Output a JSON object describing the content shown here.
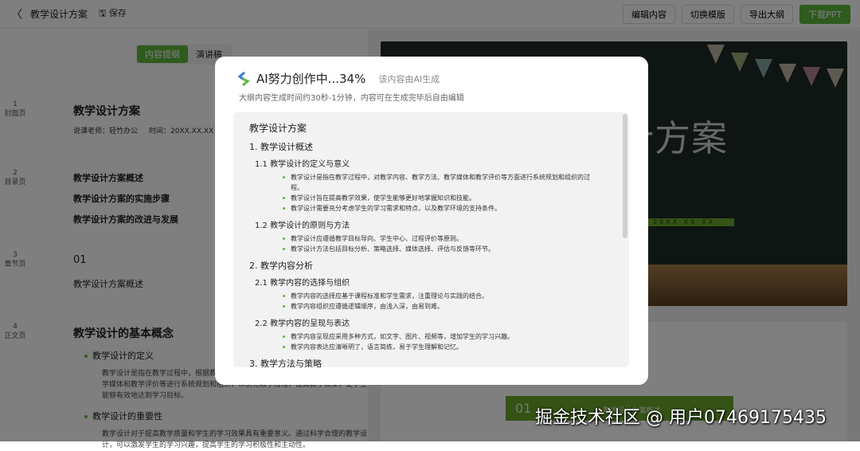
{
  "topbar": {
    "back": "〈",
    "title": "教学设计方案",
    "save": "保存",
    "buttons": [
      "编辑内容",
      "切换模版",
      "导出大纲",
      "下载PPT"
    ]
  },
  "left": {
    "tabs": [
      "内容提纲",
      "演讲稿"
    ],
    "pages": [
      {
        "no": "1",
        "type": "封面页",
        "title": "教学设计方案",
        "teacher": "说课老师：轻竹办公",
        "time": "时间：20XX.XX.XX"
      },
      {
        "no": "2",
        "type": "目录页",
        "items": [
          "教学设计方案概述",
          "教学设计方案的实施步骤",
          "教学设计方案的改进与发展"
        ]
      },
      {
        "no": "3",
        "type": "章节页",
        "num": "01",
        "title": "教学设计方案概述"
      },
      {
        "no": "4",
        "type": "正文页",
        "title": "教学设计的基本概念",
        "b1": "教学设计的定义",
        "b1t": "教学设计是指在教学过程中，根据教学目标和学生特点，对教学内容、教学方法、教学媒体和教学评价等进行系统规划和组织，以优化教学过程，提高教学效果，使学生能够有效地达到学习目标。",
        "b2": "教学设计的重要性",
        "b2t": "教学设计对于提高教学质量和学生的学习效果具有重要意义。通过科学合理的教学设计，可以激发学生的学习兴趣，提高学生的学习积极性和主动性。"
      }
    ]
  },
  "slide": {
    "title": "教学设计方案",
    "date": "20XX XX XX",
    "banner_num": "01",
    "banner_text": "教学设计方案概述"
  },
  "modal": {
    "title": "AI努力创作中...34%",
    "note": "该内容由AI生成",
    "sub": "大纲内容生成时间约30秒-1分钟，内容可在生成完毕后自由编辑",
    "outline": {
      "root": "教学设计方案",
      "s1": "1. 教学设计概述",
      "s11": "1.1 教学设计的定义与意义",
      "s11b": [
        "教学设计是指在教学过程中，对教学内容、教学方法、教学媒体和教学评价等方面进行系统规划和组织的过程。",
        "教学设计旨在提高教学效果，使学生能够更好地掌握知识和技能。",
        "教学设计需要充分考虑学生的学习需求和特点，以及教学环境的支持条件。"
      ],
      "s12": "1.2 教学设计的原则与方法",
      "s12b": [
        "教学设计应遵循教学目标导向、学生中心、过程评价等原则。",
        "教学设计方法包括目标分析、策略选择、媒体选择、评估与反馈等环节。"
      ],
      "s2": "2. 教学内容分析",
      "s21": "2.1 教学内容的选择与组织",
      "s21b": [
        "教学内容的选择应基于课程标准和学生需求，注重理论与实践的结合。",
        "教学内容组织应遵循逻辑顺序，由浅入深，由易到难。"
      ],
      "s22": "2.2 教学内容的呈现与表达",
      "s22b": [
        "教学内容呈现应采用多种方式，如文字、图片、视频等，增加学生的学习兴趣。",
        "教学内容表达应清晰明了，语言简练，易于学生理解和记忆。"
      ],
      "s3": "3. 教学方法与策略"
    }
  },
  "watermark": "掘金技术社区 @ 用户07469175435",
  "colors": {
    "accent": "#5fb63c"
  }
}
